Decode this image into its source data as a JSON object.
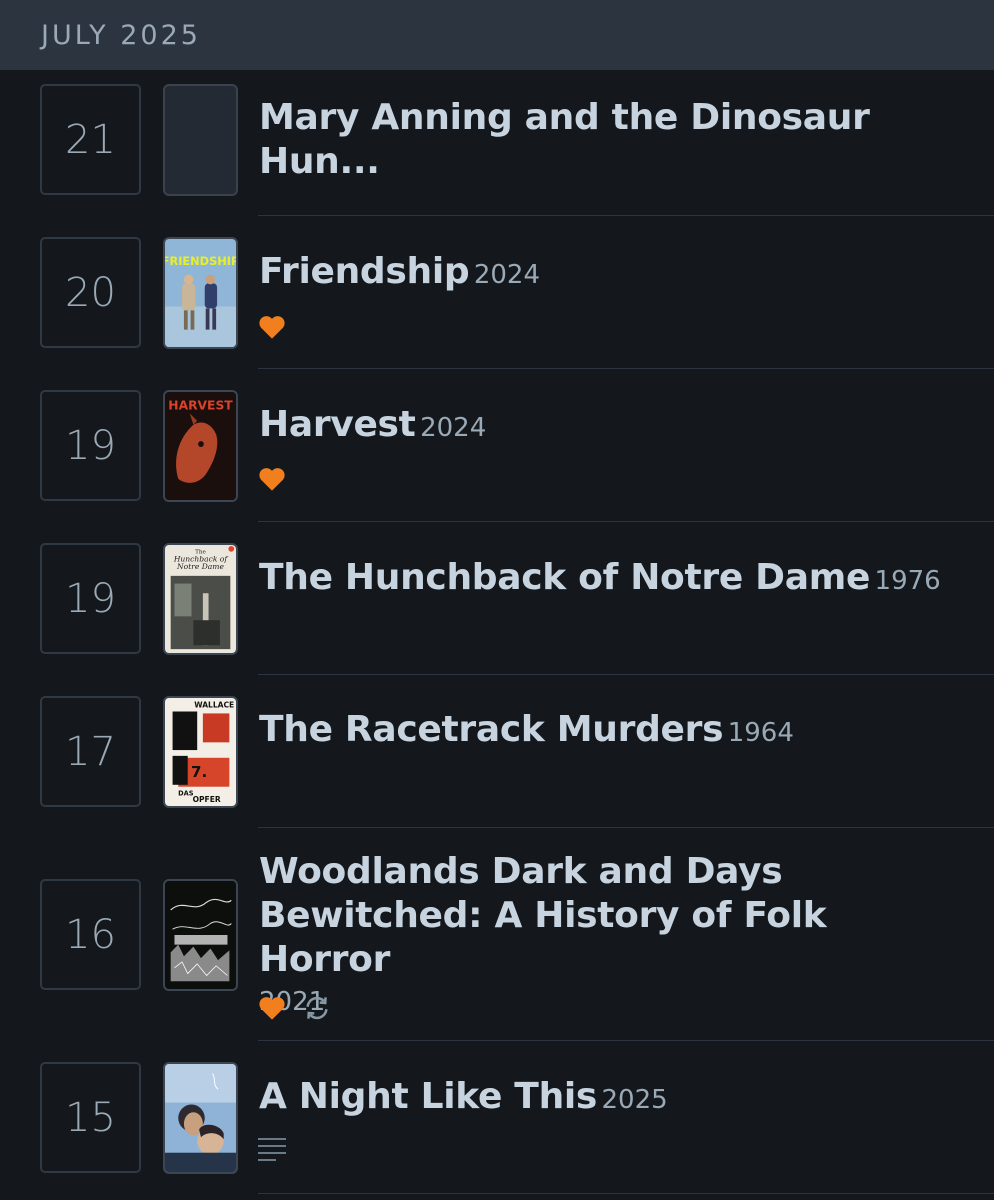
{
  "header": {
    "month": "JULY 2025"
  },
  "entries": [
    {
      "day": "21",
      "title": "Mary Anning and the Dinosaur Hun...",
      "year": "",
      "liked": false,
      "rewatch": false,
      "review": false,
      "poster": "blank"
    },
    {
      "day": "20",
      "title": "Friendship",
      "year": "2024",
      "liked": true,
      "rewatch": false,
      "review": false,
      "poster": "friendship"
    },
    {
      "day": "19",
      "title": "Harvest",
      "year": "2024",
      "liked": true,
      "rewatch": false,
      "review": false,
      "poster": "harvest"
    },
    {
      "day": "19",
      "title": "The Hunchback of Notre Dame",
      "year": "1976",
      "liked": false,
      "rewatch": false,
      "review": false,
      "poster": "hunchback"
    },
    {
      "day": "17",
      "title": "The Racetrack Murders",
      "year": "1964",
      "liked": false,
      "rewatch": false,
      "review": false,
      "poster": "racetrack"
    },
    {
      "day": "16",
      "title": "Woodlands Dark and Days Bewitched: A History of Folk Horror",
      "year": "2021",
      "liked": true,
      "rewatch": true,
      "review": false,
      "poster": "woodlands"
    },
    {
      "day": "15",
      "title": "A Night Like This",
      "year": "2025",
      "liked": false,
      "rewatch": false,
      "review": true,
      "poster": "night"
    }
  ],
  "poster_text": {
    "friendship": "FRIENDSHIP",
    "harvest": "HARVEST",
    "hunchback": [
      "The",
      "Hunchback of",
      "Notre Dame"
    ],
    "racetrack": [
      "WALLACE",
      "DAS",
      "7.",
      "OPFER"
    ]
  },
  "colors": {
    "heart": "#f27f1e",
    "muted_icon": "#8899a6",
    "background": "#14181c",
    "header": "#2c3440"
  },
  "icons": {
    "like": "heart-icon",
    "rewatch": "rewatch-icon",
    "review": "review-lines-icon"
  }
}
